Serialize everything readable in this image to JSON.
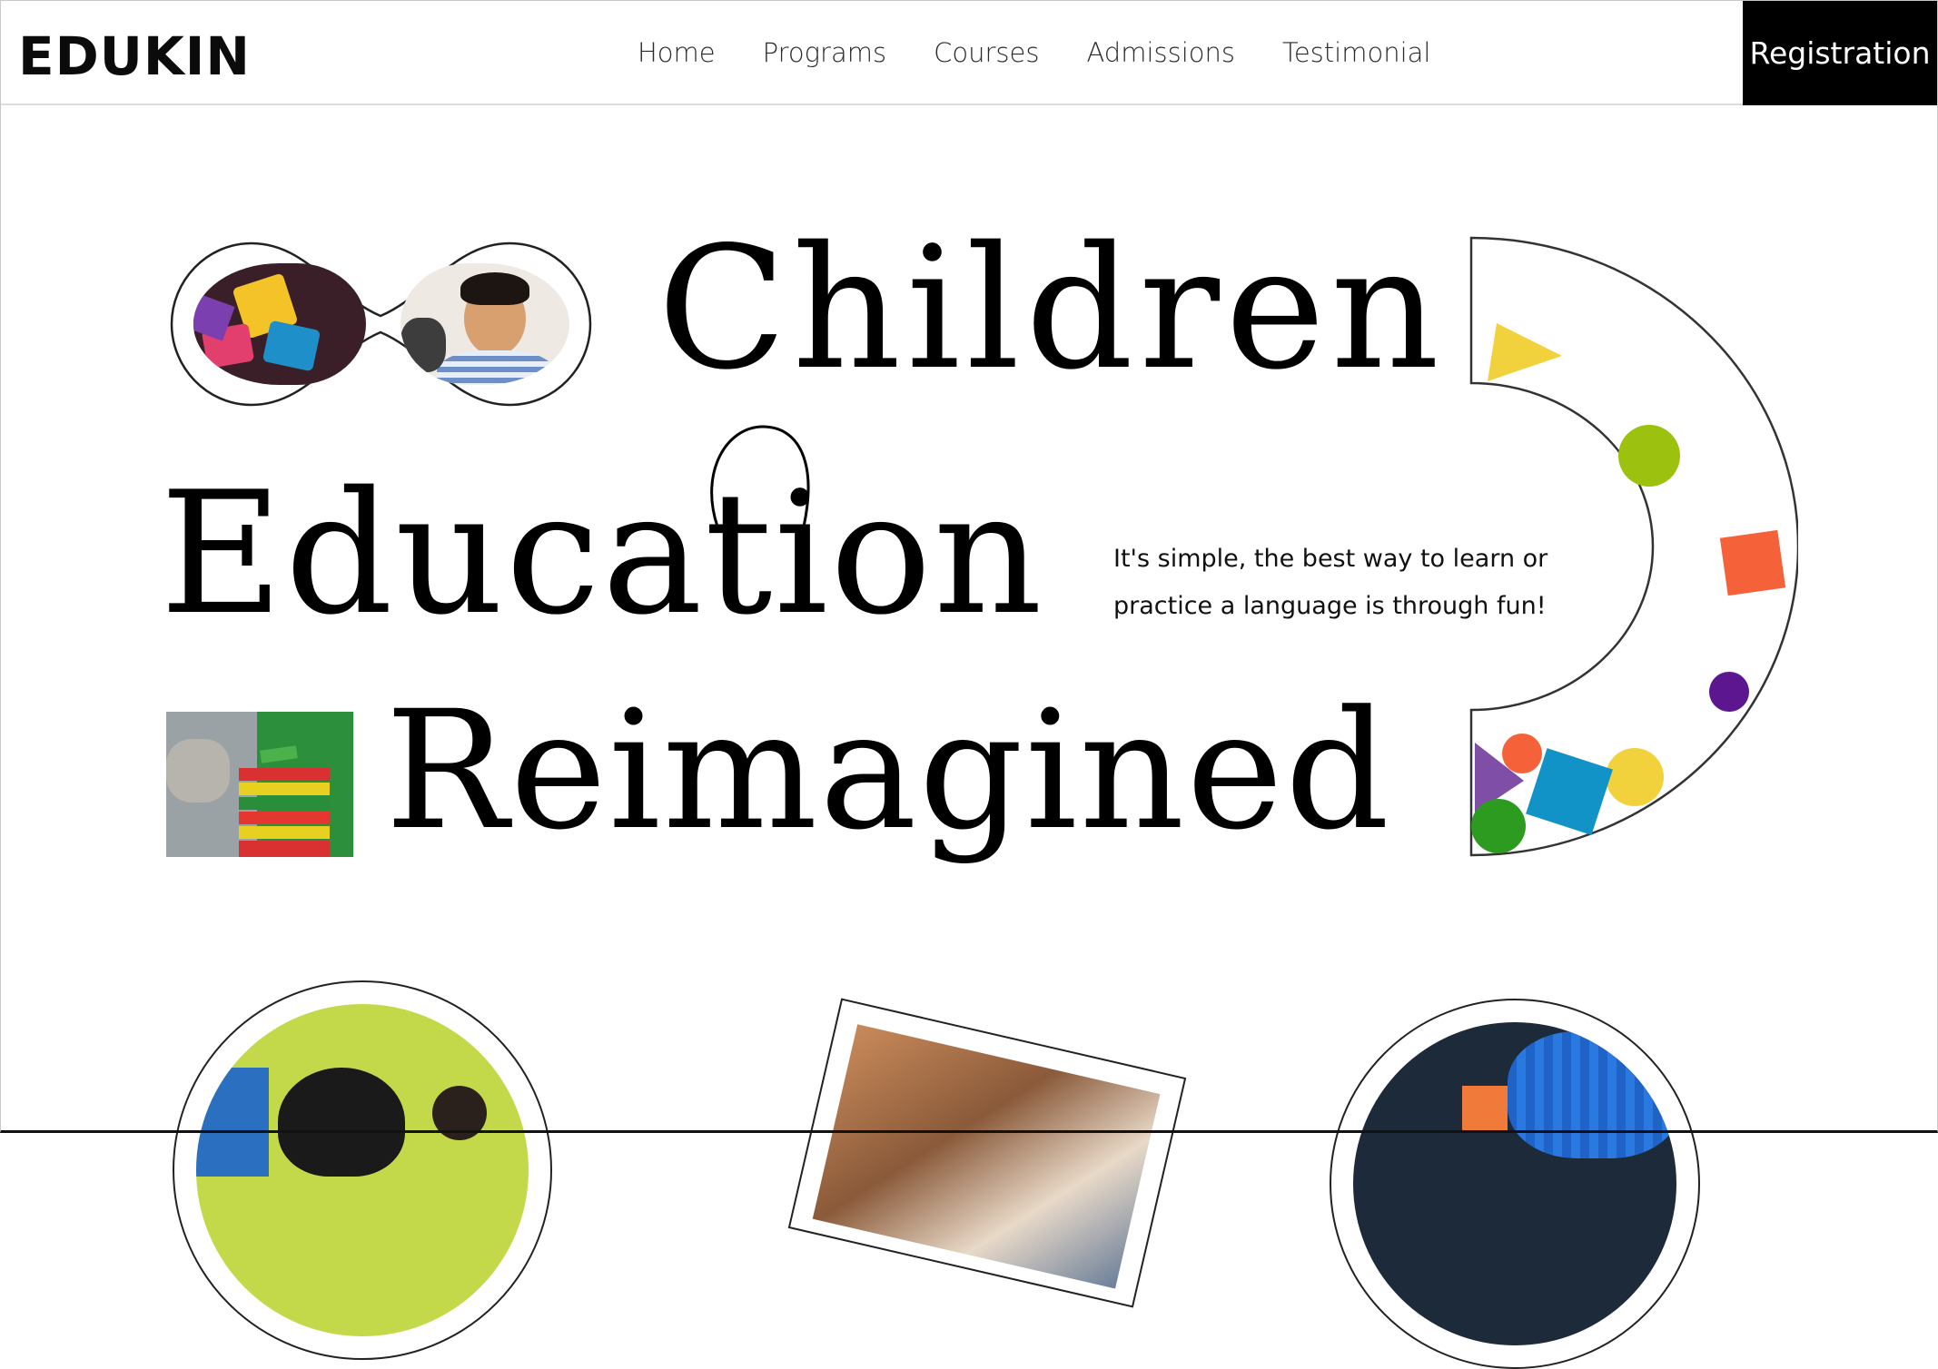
{
  "brand": {
    "name": "EDUKIN"
  },
  "nav": {
    "items": [
      {
        "label": "Home"
      },
      {
        "label": "Programs"
      },
      {
        "label": "Courses"
      },
      {
        "label": "Admissions"
      },
      {
        "label": "Testimonial"
      }
    ],
    "cta_label": "Registration"
  },
  "hero": {
    "line1": "Children",
    "line2": "Education",
    "line3": "Reimagined",
    "tagline": "It's simple, the best way to learn or practice a language is through fun!"
  },
  "colors": {
    "yellow": "#f1d23d",
    "lime": "#9dc10f",
    "orange": "#f5623a",
    "purple": "#5b1690",
    "violet": "#7f4fa8",
    "teal": "#1193c7",
    "green": "#2c9b20"
  }
}
